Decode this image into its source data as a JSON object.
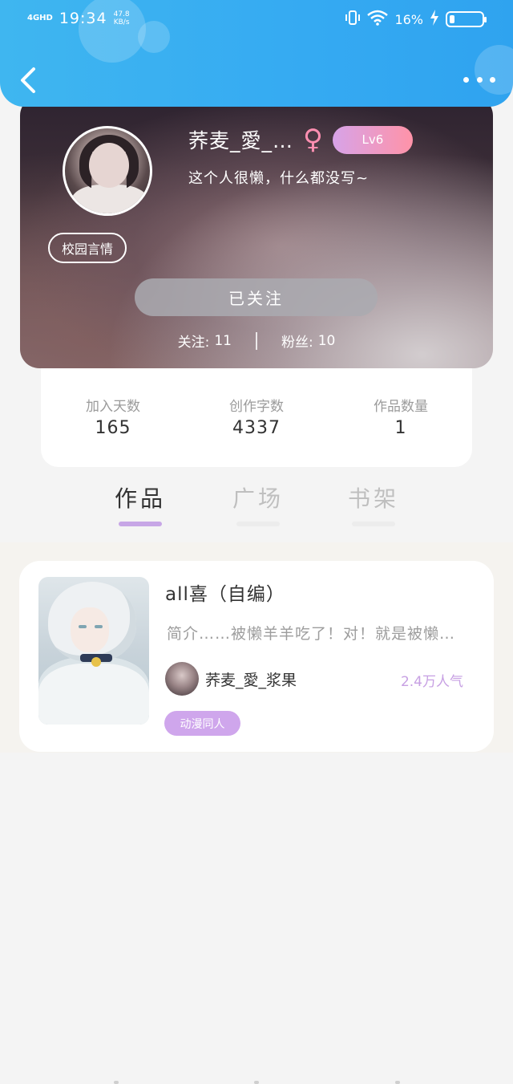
{
  "status_bar": {
    "network": "4GHD",
    "time": "19:34",
    "speed_value": "47.8",
    "speed_unit": "KB/s",
    "battery": "16%",
    "battery_level": 0.16
  },
  "header": {
    "back_icon": "chevron-left-icon",
    "more_icon": "more-dots-icon"
  },
  "profile": {
    "username": "荞麦_愛_…",
    "gender_symbol": "♀",
    "level": "Lv6",
    "bio": "这个人很懒，什么都没写~",
    "tag": "校园言情",
    "follow_label": "已关注",
    "following_label": "关注:",
    "following_count": "11",
    "fans_label": "粉丝:",
    "fans_count": "10"
  },
  "info": {
    "days_label": "加入天数",
    "days_value": "165",
    "words_label": "创作字数",
    "words_value": "4337",
    "works_label": "作品数量",
    "works_value": "1"
  },
  "tabs": [
    {
      "label": "作品",
      "active": true
    },
    {
      "label": "广场",
      "active": false
    },
    {
      "label": "书架",
      "active": false
    }
  ],
  "work": {
    "title": "all喜（自编）",
    "description": "简介……被懒羊羊吃了！对！就是被懒…",
    "author": "荞麦_愛_浆果",
    "popularity": "2.4万人气",
    "genre": "动漫同人"
  },
  "colors": {
    "header_blue": "#35aaf2",
    "accent_purple": "#c7a6e6",
    "level_gradient_start": "#d7a3e8",
    "level_gradient_end": "#ff93a8"
  }
}
